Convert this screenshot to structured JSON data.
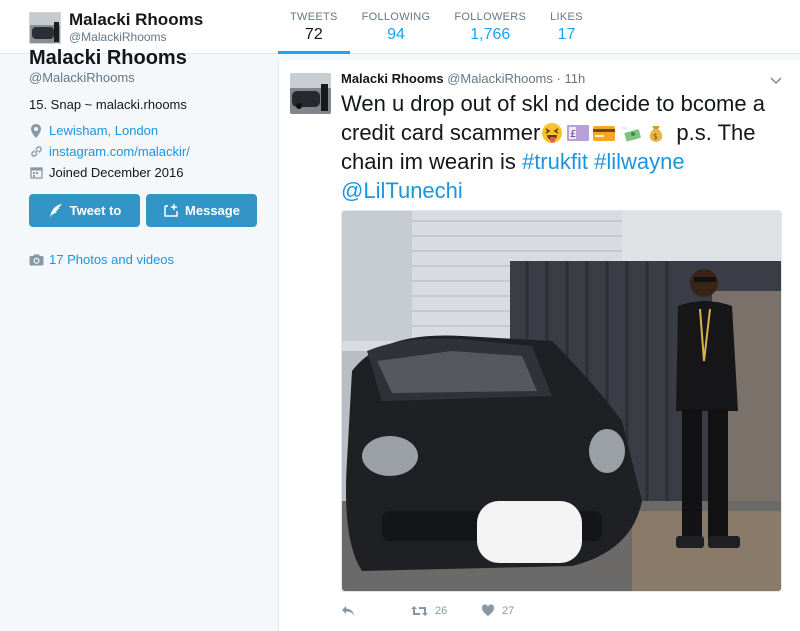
{
  "profile": {
    "name": "Malacki Rhooms",
    "handle": "@MalackiRhooms",
    "bio": "15. Snap ~ malacki.rhooms",
    "location": "Lewisham, London",
    "website": "instagram.com/malackir/",
    "joined": "Joined December 2016",
    "tweet_to_label": "Tweet to",
    "message_label": "Message",
    "photos_label": "17 Photos and videos"
  },
  "stats": [
    {
      "label": "TWEETS",
      "value": "72"
    },
    {
      "label": "FOLLOWING",
      "value": "94"
    },
    {
      "label": "FOLLOWERS",
      "value": "1,766"
    },
    {
      "label": "LIKES",
      "value": "17"
    }
  ],
  "tweet": {
    "author": "Malacki Rhooms",
    "handle": "@MalackiRhooms",
    "separator": "·",
    "time": "11h",
    "text_part1": "Wen u drop out of skl nd decide to bcome a credit card scammer",
    "text_part2": " p.s. The chain im wearin is ",
    "hashtag1": "#trukfit",
    "hashtag2": "#lilwayne",
    "mention": "@LilTunechi",
    "emojis": [
      "squinting-tongue-face",
      "pound-banknote",
      "credit-card",
      "money-with-wings",
      "money-bag"
    ],
    "retweets": "26",
    "likes": "27"
  },
  "colors": {
    "accent": "#1da1f2",
    "link": "#1b95e0",
    "button": "#3394c7"
  }
}
